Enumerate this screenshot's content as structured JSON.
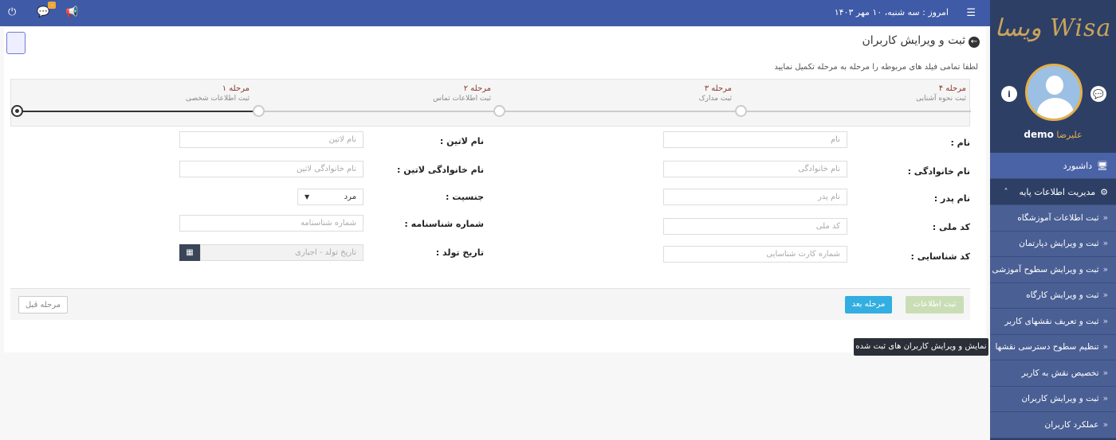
{
  "app": {
    "logo": "Wisa ویسا"
  },
  "topbar": {
    "date": "امروز : سه شنبه، ۱۰ مهر ۱۴۰۳",
    "badge": "۰"
  },
  "sidebar": {
    "user_name": "علیرضا",
    "user_handle": "demo",
    "dashboard": "داشبورد",
    "group": "مدیریت اطلاعات پایه",
    "items": [
      "ثبت اطلاعات آموزشگاه",
      "ثبت و ویرایش دپارتمان",
      "ثبت و ویرایش سطوح آموزشی",
      "ثبت و ویرایش کارگاه",
      "ثبت و تعریف نقشهای کاربر",
      "تنظیم سطوح دسترسی نقشها",
      "تخصیص نقش به کاربر",
      "ثبت و ویرایش کاربران",
      "عملکرد کاربران"
    ]
  },
  "page": {
    "title": "ثبت و ویرایش کاربران",
    "instruction": "لطفا تمامی فیلد های مربوطه را مرحله به مرحله تکمیل نمایید"
  },
  "steps": [
    {
      "title": "مرحله ۱",
      "sub": "ثبت اطلاعات شخصی"
    },
    {
      "title": "مرحله ۲",
      "sub": "ثبت اطلاعات تماس"
    },
    {
      "title": "مرحله ۳",
      "sub": "ثبت مدارک"
    },
    {
      "title": "مرحله ۴",
      "sub": "ثبت نحوه آشنایی"
    }
  ],
  "form": {
    "name_label": "نام :",
    "name_ph": "نام",
    "latin_name_label": "نام لاتین :",
    "latin_name_ph": "نام لاتین",
    "family_label": "نام خانوادگی :",
    "family_ph": "نام خانوادگی",
    "latin_family_label": "نام خانوادگی لاتین :",
    "latin_family_ph": "نام خانوادگی لاتین",
    "father_label": "نام پدر :",
    "father_ph": "نام پدر",
    "gender_label": "جنسیت :",
    "gender_value": "مرد",
    "national_label": "کد ملی :",
    "national_ph": "کد ملی",
    "shenas_label": "شماره شناسنامه :",
    "shenas_ph": "شماره شناسنامه",
    "card_label": "کد شناسایی :",
    "card_ph": "شماره کارت شناسایی",
    "birth_label": "تاریخ تولد :",
    "birth_ph": "تاریخ تولد - اجباری"
  },
  "buttons": {
    "save": "ثبت اطلاعات",
    "next": "مرحله بعد",
    "prev": "مرحله قبل"
  },
  "tooltip": "نمایش و ویرایش کاربران های ثبت شده"
}
